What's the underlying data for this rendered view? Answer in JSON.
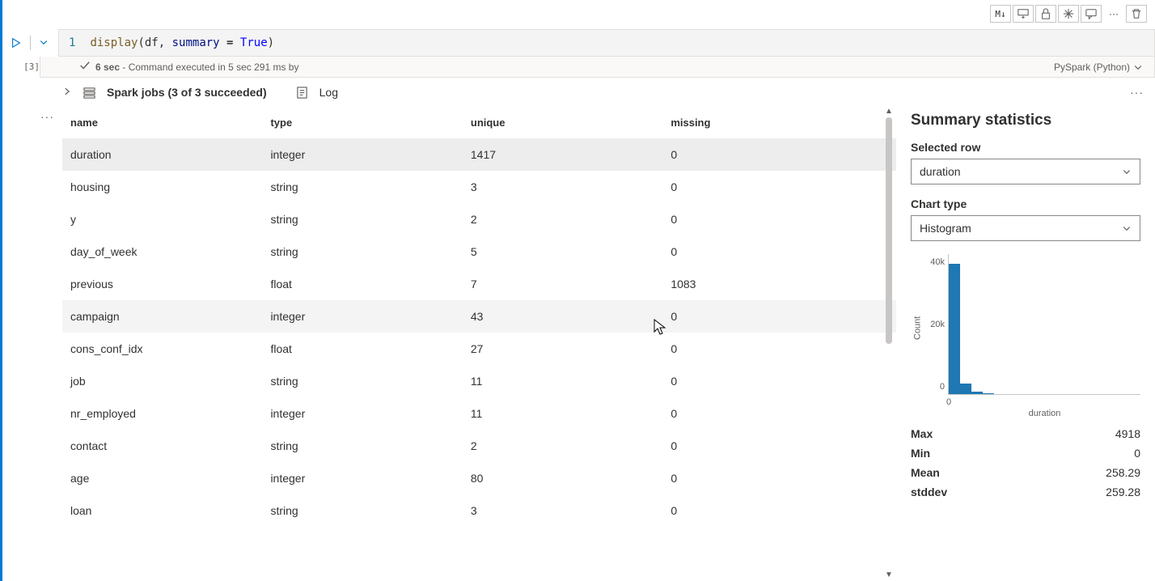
{
  "toolbar": {
    "md_label": "M↓",
    "delete_title": "Delete"
  },
  "cell": {
    "index": "[3]",
    "line_no": "1",
    "code_fn": "display",
    "code_args1": "(df, ",
    "code_param": "summary",
    "code_eq": " = ",
    "code_lit": "True",
    "code_close": ")"
  },
  "status": {
    "time": "6 sec",
    "exec_msg": " - Command executed in 5 sec 291 ms by",
    "language": "PySpark (Python)"
  },
  "jobs": {
    "label": "Spark jobs (3 of 3 succeeded)",
    "log": "Log"
  },
  "table": {
    "headers": [
      "name",
      "type",
      "unique",
      "missing"
    ],
    "rows": [
      {
        "name": "duration",
        "type": "integer",
        "unique": "1417",
        "missing": "0",
        "state": "selected"
      },
      {
        "name": "housing",
        "type": "string",
        "unique": "3",
        "missing": "0",
        "state": ""
      },
      {
        "name": "y",
        "type": "string",
        "unique": "2",
        "missing": "0",
        "state": ""
      },
      {
        "name": "day_of_week",
        "type": "string",
        "unique": "5",
        "missing": "0",
        "state": ""
      },
      {
        "name": "previous",
        "type": "float",
        "unique": "7",
        "missing": "1083",
        "state": ""
      },
      {
        "name": "campaign",
        "type": "integer",
        "unique": "43",
        "missing": "0",
        "state": "hover"
      },
      {
        "name": "cons_conf_idx",
        "type": "float",
        "unique": "27",
        "missing": "0",
        "state": ""
      },
      {
        "name": "job",
        "type": "string",
        "unique": "11",
        "missing": "0",
        "state": ""
      },
      {
        "name": "nr_employed",
        "type": "integer",
        "unique": "11",
        "missing": "0",
        "state": ""
      },
      {
        "name": "contact",
        "type": "string",
        "unique": "2",
        "missing": "0",
        "state": ""
      },
      {
        "name": "age",
        "type": "integer",
        "unique": "80",
        "missing": "0",
        "state": ""
      },
      {
        "name": "loan",
        "type": "string",
        "unique": "3",
        "missing": "0",
        "state": ""
      }
    ]
  },
  "panel": {
    "title": "Summary statistics",
    "row_label": "Selected row",
    "row_value": "duration",
    "chart_label": "Chart type",
    "chart_value": "Histogram",
    "legend": "duration"
  },
  "chart_data": {
    "type": "bar",
    "title": "",
    "xlabel": "duration",
    "ylabel": "Count",
    "ylim": [
      0,
      40000
    ],
    "yticks": [
      "40k",
      "20k",
      "0"
    ],
    "xtick": "0",
    "categories": [
      "bin0",
      "bin1",
      "bin2",
      "bin3"
    ],
    "values": [
      38000,
      3000,
      800,
      300
    ],
    "legend": "duration"
  },
  "stats": [
    {
      "label": "Max",
      "value": "4918"
    },
    {
      "label": "Min",
      "value": "0"
    },
    {
      "label": "Mean",
      "value": "258.29"
    },
    {
      "label": "stddev",
      "value": "259.28"
    }
  ]
}
